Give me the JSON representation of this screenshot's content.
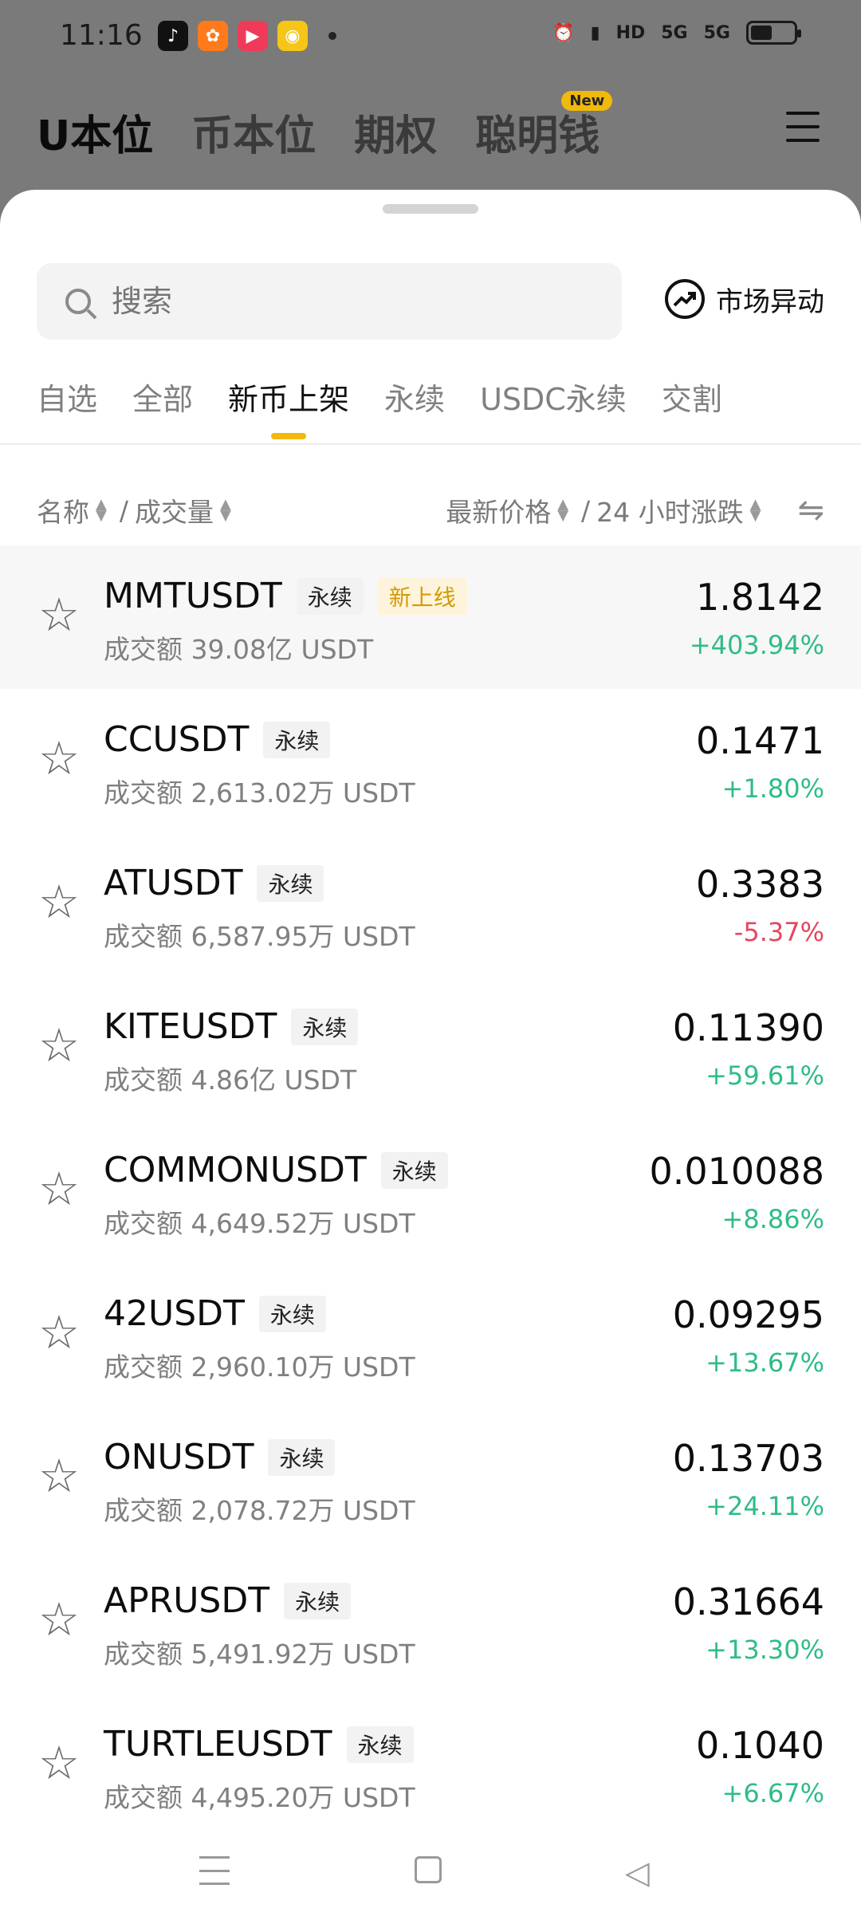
{
  "status_bar": {
    "time": "11:16",
    "hd_label": "HD",
    "net1": "5G",
    "net2": "5G"
  },
  "top_tabs": [
    {
      "label": "U本位",
      "active": true
    },
    {
      "label": "币本位"
    },
    {
      "label": "期权"
    },
    {
      "label": "聪明钱",
      "badge": "New"
    }
  ],
  "search": {
    "placeholder": "搜索"
  },
  "market_move_label": "市场异动",
  "category_tabs": [
    {
      "label": "自选"
    },
    {
      "label": "全部"
    },
    {
      "label": "新币上架",
      "active": true
    },
    {
      "label": "永续"
    },
    {
      "label": "USDC永续"
    },
    {
      "label": "交割"
    }
  ],
  "sort": {
    "name": "名称",
    "sep1": "/",
    "volume": "成交量",
    "price": "最新价格",
    "sep2": "/",
    "change": "24 小时涨跌"
  },
  "rows": [
    {
      "symbol": "MMTUSDT",
      "tag": "永续",
      "new_tag": "新上线",
      "volume": "成交额 39.08亿 USDT",
      "price": "1.8142",
      "change": "+403.94%",
      "direction": "up"
    },
    {
      "symbol": "CCUSDT",
      "tag": "永续",
      "volume": "成交额 2,613.02万 USDT",
      "price": "0.1471",
      "change": "+1.80%",
      "direction": "up"
    },
    {
      "symbol": "ATUSDT",
      "tag": "永续",
      "volume": "成交额 6,587.95万 USDT",
      "price": "0.3383",
      "change": "-5.37%",
      "direction": "down"
    },
    {
      "symbol": "KITEUSDT",
      "tag": "永续",
      "volume": "成交额 4.86亿 USDT",
      "price": "0.11390",
      "change": "+59.61%",
      "direction": "up"
    },
    {
      "symbol": "COMMONUSDT",
      "tag": "永续",
      "volume": "成交额 4,649.52万 USDT",
      "price": "0.010088",
      "change": "+8.86%",
      "direction": "up"
    },
    {
      "symbol": "42USDT",
      "tag": "永续",
      "volume": "成交额 2,960.10万 USDT",
      "price": "0.09295",
      "change": "+13.67%",
      "direction": "up"
    },
    {
      "symbol": "ONUSDT",
      "tag": "永续",
      "volume": "成交额 2,078.72万 USDT",
      "price": "0.13703",
      "change": "+24.11%",
      "direction": "up"
    },
    {
      "symbol": "APRUSDT",
      "tag": "永续",
      "volume": "成交额 5,491.92万 USDT",
      "price": "0.31664",
      "change": "+13.30%",
      "direction": "up"
    },
    {
      "symbol": "TURTLEUSDT",
      "tag": "永续",
      "volume": "成交额 4,495.20万 USDT",
      "price": "0.1040",
      "change": "+6.67%",
      "direction": "up"
    }
  ]
}
